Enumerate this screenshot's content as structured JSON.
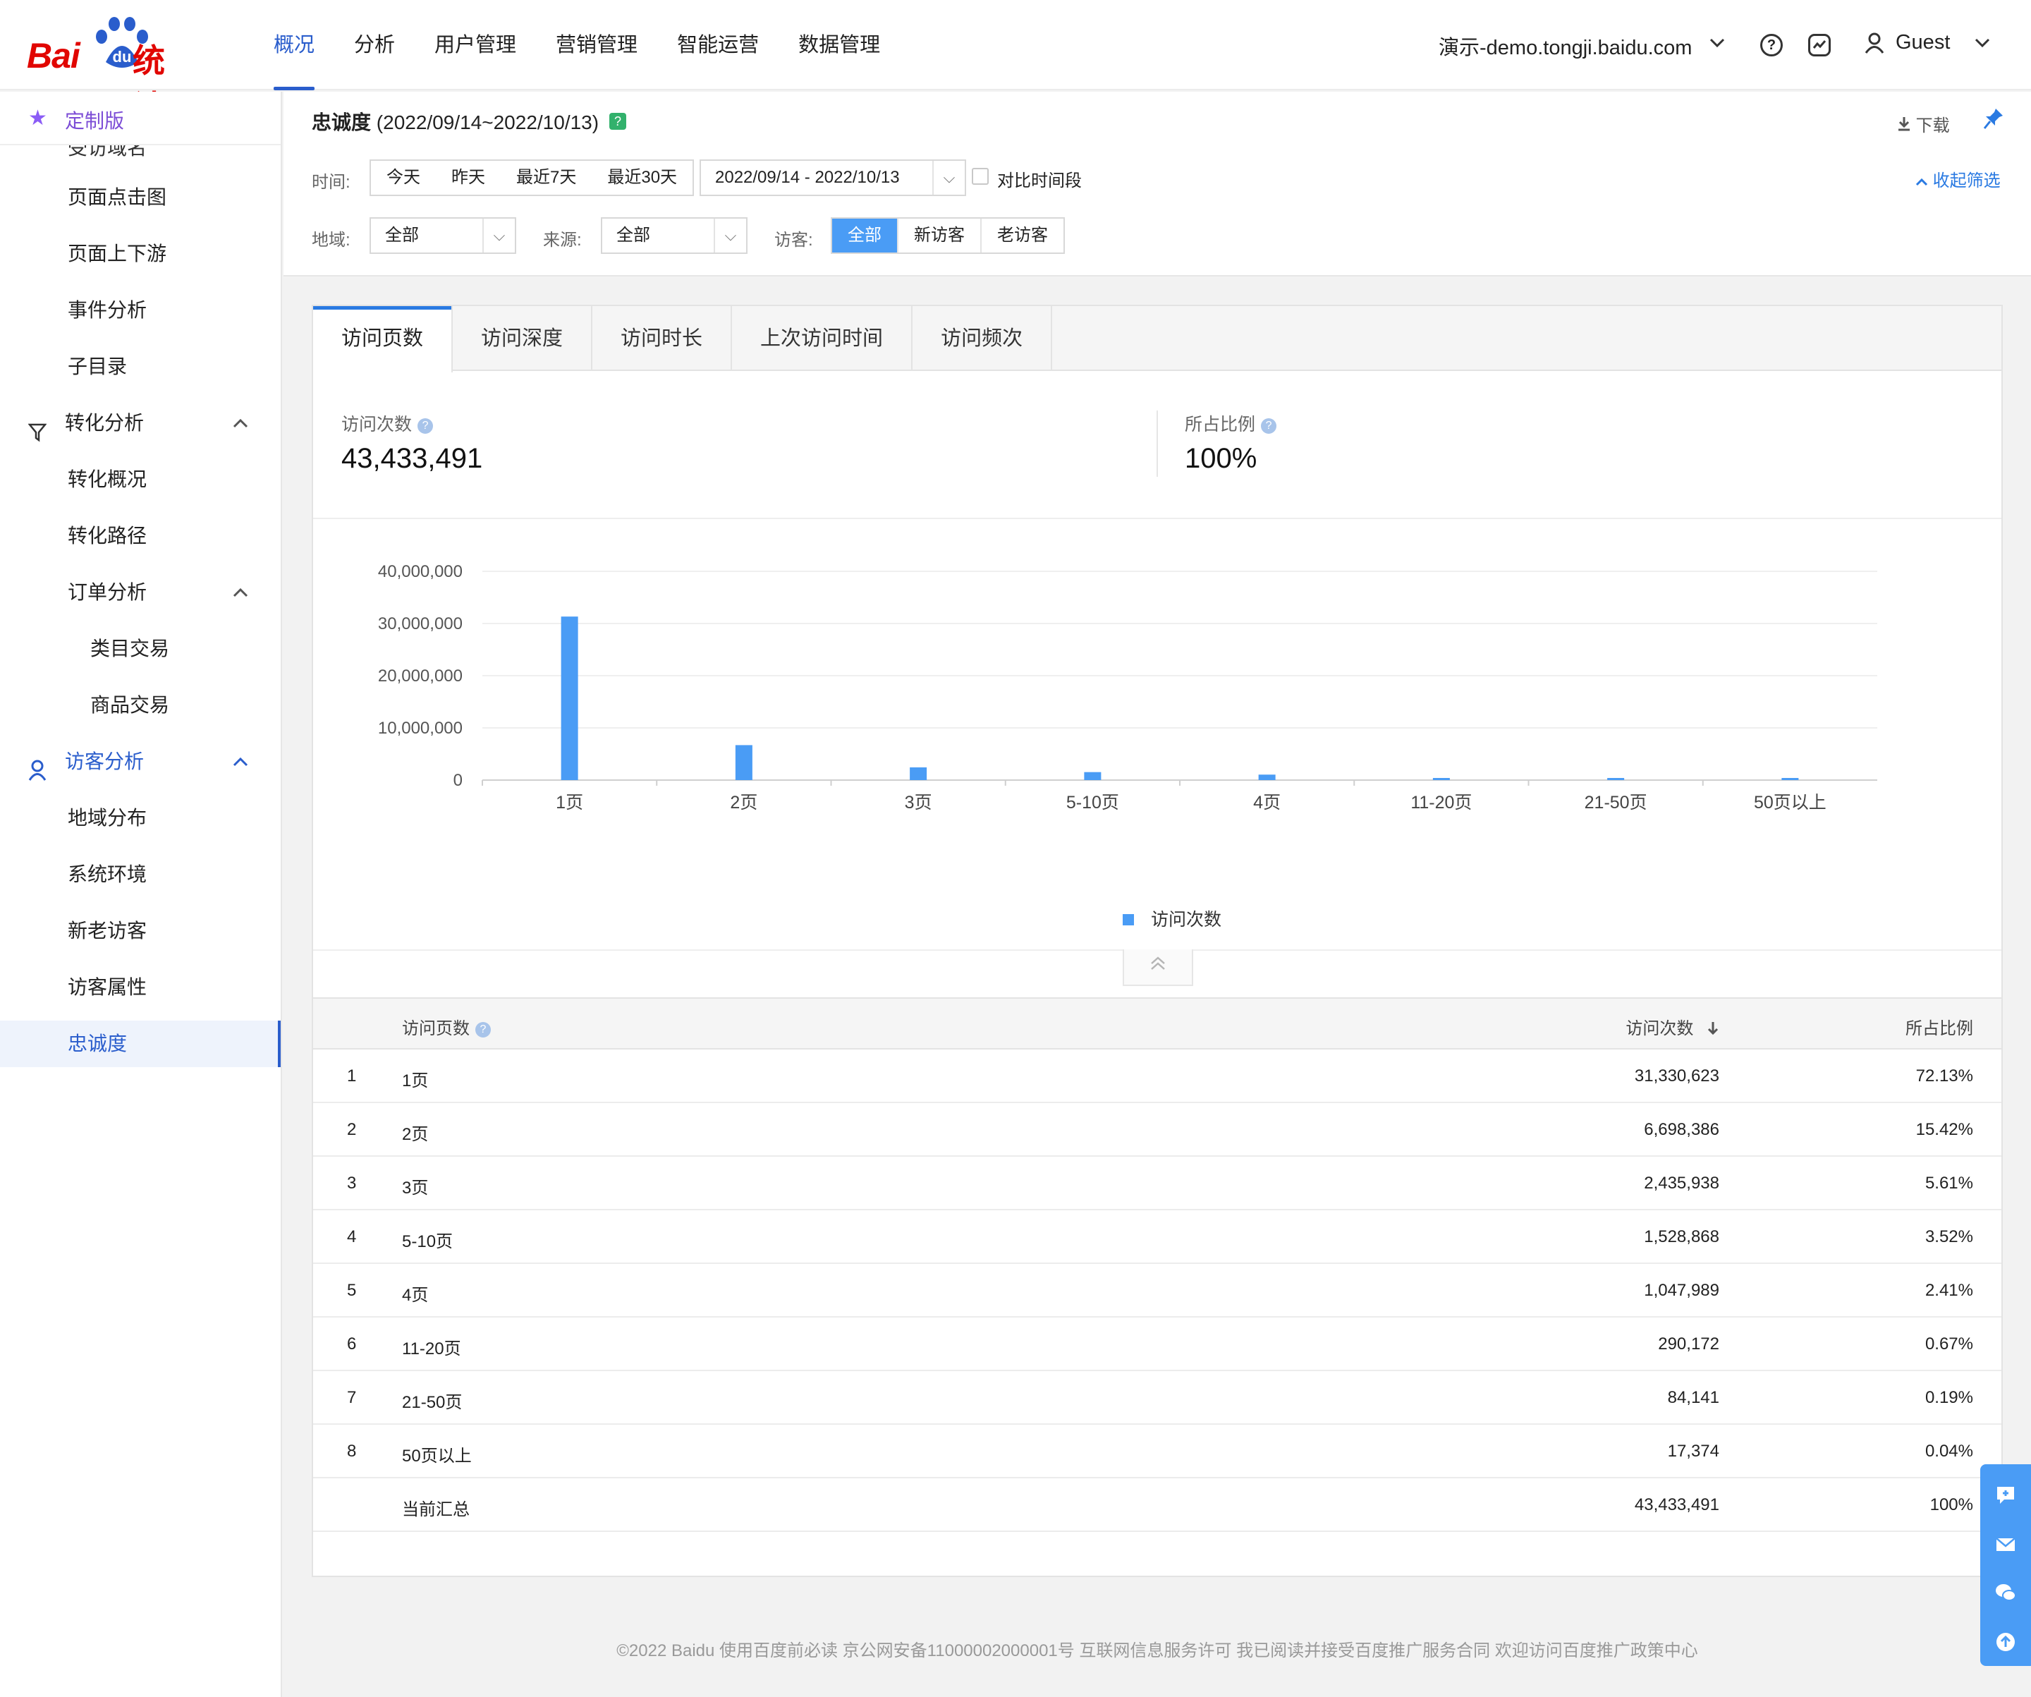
{
  "header": {
    "nav": [
      "概况",
      "分析",
      "用户管理",
      "营销管理",
      "智能运营",
      "数据管理"
    ],
    "active_nav": 0,
    "site": "演示-demo.tongji.baidu.com",
    "user": "Guest"
  },
  "sidebar": {
    "custom_label": "定制版",
    "partial_label": "受访域名",
    "items": [
      {
        "label": "页面点击图"
      },
      {
        "label": "页面上下游"
      },
      {
        "label": "事件分析"
      },
      {
        "label": "子目录"
      },
      {
        "label": "转化分析"
      },
      {
        "label": "转化概况"
      },
      {
        "label": "转化路径"
      },
      {
        "label": "订单分析"
      },
      {
        "label": "类目交易"
      },
      {
        "label": "商品交易"
      },
      {
        "label": "访客分析"
      },
      {
        "label": "地域分布"
      },
      {
        "label": "系统环境"
      },
      {
        "label": "新老访客"
      },
      {
        "label": "访客属性"
      },
      {
        "label": "忠诚度"
      }
    ]
  },
  "filters": {
    "title": "忠诚度",
    "range": "(2022/09/14~2022/10/13)",
    "download": "下载",
    "time_label": "时间:",
    "time_options": [
      "今天",
      "昨天",
      "最近7天",
      "最近30天"
    ],
    "date_range": "2022/09/14 - 2022/10/13",
    "compare": "对比时间段",
    "collapse": "收起筛选",
    "region_label": "地域:",
    "region_value": "全部",
    "source_label": "来源:",
    "source_value": "全部",
    "visitor_label": "访客:",
    "visitor_options": [
      "全部",
      "新访客",
      "老访客"
    ],
    "visitor_active": 0
  },
  "tabs": [
    "访问页数",
    "访问深度",
    "访问时长",
    "上次访问时间",
    "访问频次"
  ],
  "active_tab": 0,
  "metrics": {
    "visits_label": "访问次数",
    "visits_value": "43,433,491",
    "ratio_label": "所占比例",
    "ratio_value": "100%"
  },
  "chart_data": {
    "type": "bar",
    "categories": [
      "1页",
      "2页",
      "3页",
      "5-10页",
      "4页",
      "11-20页",
      "21-50页",
      "50页以上"
    ],
    "series": [
      {
        "name": "访问次数",
        "values": [
          31330623,
          6698386,
          2435938,
          1528868,
          1047989,
          290172,
          84141,
          17374
        ]
      }
    ],
    "ylim": [
      0,
      40000000
    ],
    "yticks": [
      "0",
      "10,000,000",
      "20,000,000",
      "30,000,000",
      "40,000,000"
    ],
    "grid": true,
    "legend": "bottom",
    "color": "#4a9cf5"
  },
  "table": {
    "headers": {
      "page": "访问页数",
      "visits": "访问次数",
      "ratio": "所占比例"
    },
    "rows": [
      {
        "idx": "1",
        "page": "1页",
        "visits": "31,330,623",
        "ratio": "72.13%"
      },
      {
        "idx": "2",
        "page": "2页",
        "visits": "6,698,386",
        "ratio": "15.42%"
      },
      {
        "idx": "3",
        "page": "3页",
        "visits": "2,435,938",
        "ratio": "5.61%"
      },
      {
        "idx": "4",
        "page": "5-10页",
        "visits": "1,528,868",
        "ratio": "3.52%"
      },
      {
        "idx": "5",
        "page": "4页",
        "visits": "1,047,989",
        "ratio": "2.41%"
      },
      {
        "idx": "6",
        "page": "11-20页",
        "visits": "290,172",
        "ratio": "0.67%"
      },
      {
        "idx": "7",
        "page": "21-50页",
        "visits": "84,141",
        "ratio": "0.19%"
      },
      {
        "idx": "8",
        "page": "50页以上",
        "visits": "17,374",
        "ratio": "0.04%"
      }
    ],
    "total": {
      "label": "当前汇总",
      "visits": "43,433,491",
      "ratio": "100%"
    }
  },
  "footer": "©2022 Baidu 使用百度前必读 京公网安备11000002000001号 互联网信息服务许可 我已阅读并接受百度推广服务合同 欢迎访问百度推广政策中心",
  "colors": {
    "accent": "#2a5dcc",
    "bar": "#4a9cf5",
    "brand": "#e10601"
  }
}
